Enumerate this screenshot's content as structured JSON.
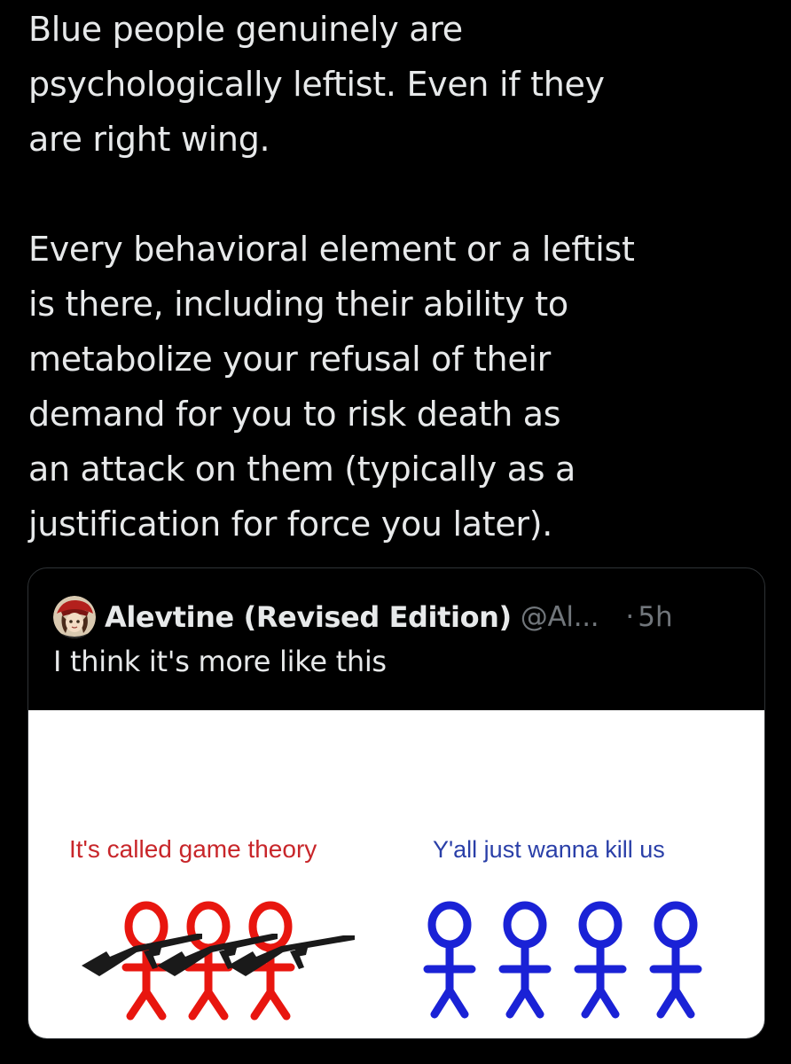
{
  "tweet": {
    "text_lines": [
      "Blue people genuinely are",
      "psychologically leftist. Even if they",
      "are right wing.",
      "",
      "Every behavioral element or a leftist",
      "is there, including their ability to",
      "metabolize your refusal of their",
      "demand for you to risk death as",
      "an attack on them (typically as a",
      "justification for force you later)."
    ]
  },
  "quote": {
    "author_name": "Alevtine (Revised Edition)",
    "author_handle": "@Al...",
    "separator": "·",
    "time": "5h",
    "text": "I think it's more like this",
    "meme": {
      "left_caption": "It's called game theory",
      "right_caption": "Y'all just wanna kill us",
      "left_color": "#e8160f",
      "right_color": "#1a22d6"
    }
  },
  "colors": {
    "background": "#000000",
    "text_primary": "#e7e9ea",
    "text_secondary": "#71767b",
    "border": "#2f3336"
  }
}
